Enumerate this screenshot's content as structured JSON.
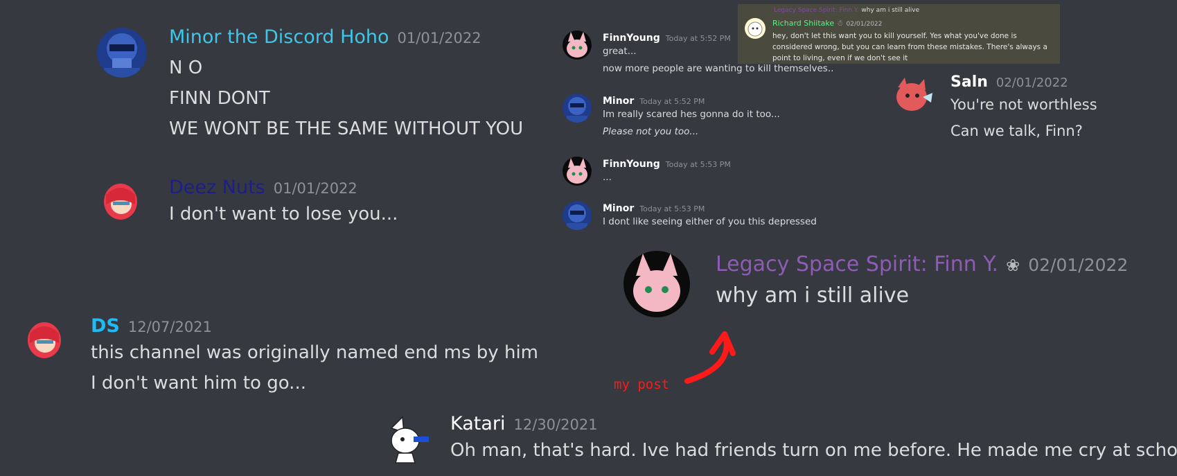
{
  "messages_left": [
    {
      "author": "Minor the Discord Hoho",
      "author_color": "#3fc6e8",
      "date": "01/01/2022",
      "avatar_icon": "blue-robot-avatar",
      "lines": [
        "N O",
        "FINN DONT",
        "WE WONT BE THE SAME WITHOUT YOU"
      ]
    },
    {
      "author": "Deez Nuts",
      "author_color": "#1c1f8a",
      "date": "01/01/2022",
      "avatar_icon": "red-haired-girl-avatar",
      "lines": [
        "I don't want to lose you..."
      ]
    },
    {
      "author": "DS",
      "author_color": "#1ebcf2",
      "date": "12/07/2021",
      "avatar_icon": "red-haired-girl-avatar",
      "lines": [
        "this channel was originally named end ms by him",
        "I don't want him to go..."
      ]
    },
    {
      "author": "Katari",
      "author_color": "#ffffff",
      "date": "12/30/2021",
      "avatar_icon": "white-creature-avatar",
      "lines": [
        "Oh man, that's hard. Ive had friends turn on me before. He made me cry at school..."
      ]
    }
  ],
  "small_chat": [
    {
      "author": "FinnYoung",
      "date": "Today at 5:52 PM",
      "avatar_icon": "pink-bunny-avatar",
      "lines": [
        "great...",
        "now more people are wanting to kill themselves.."
      ]
    },
    {
      "author": "Minor",
      "date": "Today at 5:52 PM",
      "avatar_icon": "blue-robot-avatar",
      "lines": [
        "Im really scared hes gonna do it too...",
        "Please not you too..."
      ]
    },
    {
      "author": "FinnYoung",
      "date": "Today at 5:53 PM",
      "avatar_icon": "pink-bunny-avatar",
      "lines": [
        "..."
      ]
    },
    {
      "author": "Minor",
      "date": "Today at 5:53 PM",
      "avatar_icon": "blue-robot-avatar",
      "lines": [
        "I dont like seeing either of you this depressed"
      ]
    }
  ],
  "reply": {
    "ref_author": "Legacy Space Spirit: Finn Y.",
    "ref_text": "why am i still alive",
    "author": "Richard Shiitake",
    "date": "02/01/2022",
    "text": "hey, don't let this want you to kill yourself. Yes what you've done is considered wrong, but you can learn from these mistakes. There's always a point to living, even if we don't see it"
  },
  "saln": {
    "author": "Saln",
    "date": "02/01/2022",
    "avatar_icon": "red-creature-avatar",
    "lines": [
      "You're not worthless",
      "Can we talk, Finn?"
    ]
  },
  "finn_post": {
    "author": "Legacy Space Spirit: Finn Y.",
    "author_color": "#8e5cb5",
    "date": "02/01/2022",
    "avatar_icon": "pink-bunny-avatar",
    "badge_icon": "spirit-badge-icon",
    "lines": [
      "why am i still alive"
    ]
  },
  "annotation": {
    "label": "my post",
    "color": "#ff1a1a"
  }
}
